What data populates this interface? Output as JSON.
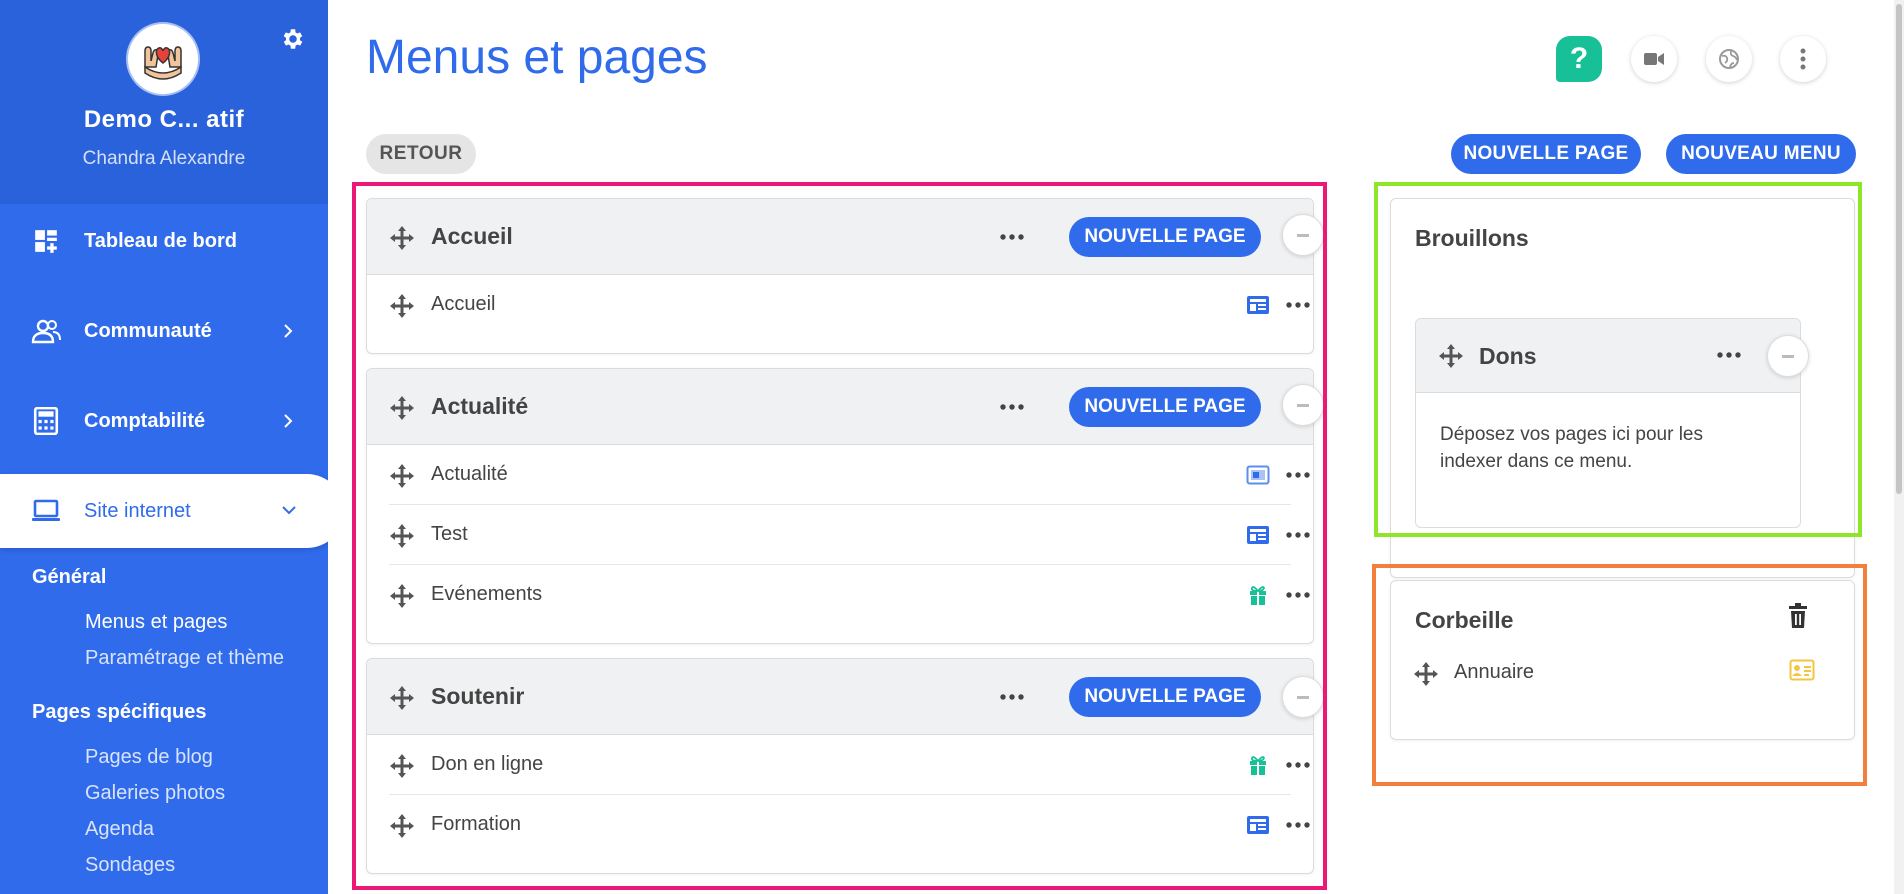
{
  "sidebar": {
    "org_name": "Demo C... atif",
    "user_name": "Chandra Alexandre",
    "nav": {
      "dashboard": "Tableau de bord",
      "community": "Communauté",
      "accounting": "Comptabilité",
      "website": "Site internet"
    },
    "groups": {
      "general": "Général",
      "specific": "Pages spécifiques"
    },
    "sub": {
      "menus_pages": "Menus et pages",
      "settings_theme": "Paramétrage et thème",
      "blog": "Pages de blog",
      "galleries": "Galeries photos",
      "agenda": "Agenda",
      "polls": "Sondages"
    }
  },
  "header": {
    "title": "Menus et pages",
    "help_label": "?"
  },
  "toolbar": {
    "back": "RETOUR",
    "new_page": "NOUVELLE PAGE",
    "new_menu": "NOUVEAU MENU"
  },
  "menus": [
    {
      "title": "Accueil",
      "new_page": "NOUVELLE PAGE",
      "pages": [
        {
          "label": "Accueil",
          "type_icon": "layout-page-icon"
        }
      ]
    },
    {
      "title": "Actualité",
      "new_page": "NOUVELLE PAGE",
      "pages": [
        {
          "label": "Actualité",
          "type_icon": "news-page-icon"
        },
        {
          "label": "Test",
          "type_icon": "layout-page-icon"
        },
        {
          "label": "Evénements",
          "type_icon": "gift-page-icon"
        }
      ]
    },
    {
      "title": "Soutenir",
      "new_page": "NOUVELLE PAGE",
      "pages": [
        {
          "label": "Don en ligne",
          "type_icon": "gift-page-icon"
        },
        {
          "label": "Formation",
          "type_icon": "layout-page-icon"
        }
      ]
    }
  ],
  "drafts": {
    "title": "Brouillons",
    "menu_title": "Dons",
    "empty_text": "Déposez vos pages ici pour les indexer dans ce menu."
  },
  "trash": {
    "title": "Corbeille",
    "pages": [
      {
        "label": "Annuaire",
        "type_icon": "contact-card-icon"
      }
    ]
  },
  "colors": {
    "primary": "#306bec",
    "help": "#17c096",
    "frame_menus": "#ec1878",
    "frame_drafts": "#8fe628",
    "frame_trash": "#f2803c"
  }
}
